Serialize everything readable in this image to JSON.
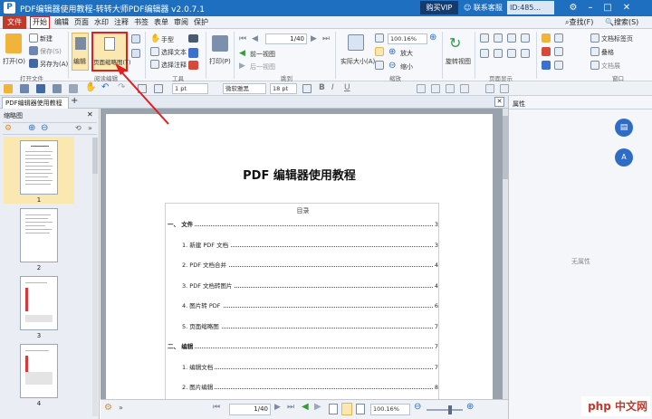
{
  "titlebar": {
    "title": "PDF编辑器使用教程-转转大师PDF编辑器 v2.0.7.1",
    "buy_vip": "购买VIP",
    "service": "联系客服",
    "user_id": "ID:485..."
  },
  "menu": {
    "items": [
      "文件",
      "开始",
      "编辑",
      "页面",
      "水印",
      "注释",
      "书签",
      "表单",
      "审阅",
      "保护"
    ],
    "find": "查找(F)",
    "search": "搜索(S)"
  },
  "ribbon": {
    "new": "新建",
    "save": "保存(S)",
    "open": "打开(O)",
    "save_as": "另存为(A)",
    "group_open": "打开文件",
    "edit": "编辑",
    "thumb_view": "页面缩略图(T)",
    "group_read": "阅读编辑",
    "hand": "手型",
    "select_text": "选择文本",
    "select_annot": "选择注释",
    "group_tools": "工具",
    "print": "打印(P)",
    "page_input": "1",
    "page_total": "/40",
    "prev_view": "前一视图",
    "next_view": "后一视图",
    "group_jump": "跳到",
    "actual_size": "实际大小(A)",
    "zoom": "100.16%",
    "zoom_in": "放大",
    "zoom_out": "缩小",
    "group_zoom": "缩放",
    "rotate": "旋转视图",
    "group_page_display": "页面显示",
    "doc_tabs": "文档标签页",
    "tile": "叠格",
    "doc_split": "文档展",
    "group_window": "窗口"
  },
  "quickbar": {
    "font_size": "1 pt",
    "font": "微软雅黑",
    "text_size": "18 pt"
  },
  "tabs": {
    "doc": "PDF编辑器使用教程"
  },
  "left_panel": {
    "title": "缩略图",
    "pages": [
      "1",
      "2",
      "3",
      "4"
    ]
  },
  "document": {
    "title": "PDF 编辑器使用教程",
    "toc_heading": "目录",
    "toc": [
      {
        "label": "一、  文件",
        "page": "3",
        "level": 0
      },
      {
        "label": "1. 新建 PDF 文档",
        "page": "3",
        "level": 1
      },
      {
        "label": "2. PDF 文档合并",
        "page": "4",
        "level": 1
      },
      {
        "label": "3. PDF 文档转图片",
        "page": "4",
        "level": 1
      },
      {
        "label": "4. 图片转 PDF",
        "page": "6",
        "level": 1
      },
      {
        "label": "5. 页面缩略图",
        "page": "7",
        "level": 1
      },
      {
        "label": "二、 编辑",
        "page": "7",
        "level": 0
      },
      {
        "label": "1. 编辑文档",
        "page": "7",
        "level": 1
      },
      {
        "label": "2. 图片编辑",
        "page": "8",
        "level": 1
      }
    ]
  },
  "right_panel": {
    "title": "属性",
    "empty": "无属性"
  },
  "status": {
    "page": "1",
    "total": "/40",
    "zoom": "100.16%"
  },
  "watermark": {
    "text": "php 中文网"
  },
  "colors": {
    "title_blue": "#1f6fc0",
    "highlight_red": "#e02020",
    "file_red": "#c0392b"
  }
}
